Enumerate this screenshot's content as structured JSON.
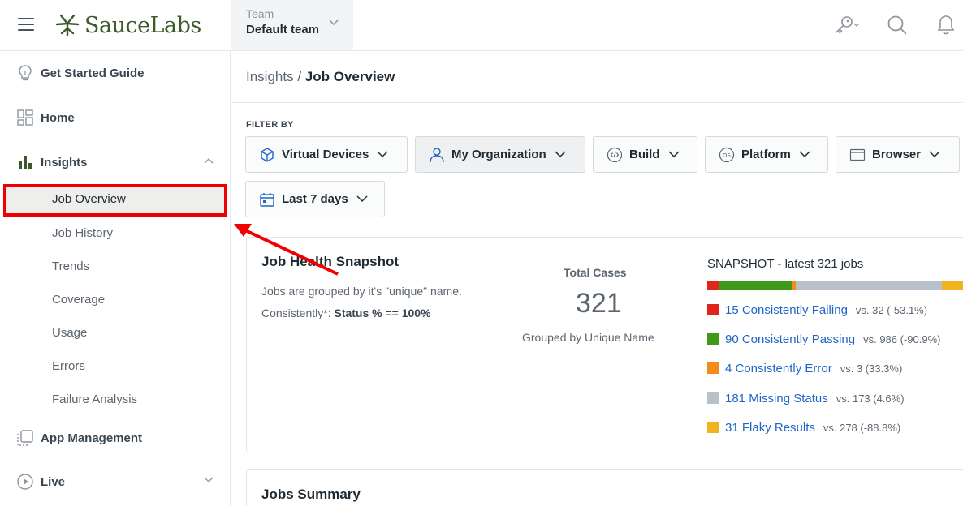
{
  "brand": {
    "name": "SauceLabs",
    "color": "#3d5a2a"
  },
  "team": {
    "label": "Team",
    "value": "Default team"
  },
  "topbar_icons": [
    "key-icon",
    "search-icon",
    "bell-icon"
  ],
  "sidebar": {
    "items": [
      {
        "label": "Get Started Guide",
        "icon": "lightbulb-icon"
      },
      {
        "label": "Home",
        "icon": "home-grid-icon"
      },
      {
        "label": "Insights",
        "icon": "bar-chart-icon",
        "expanded": true
      },
      {
        "label": "App Management",
        "icon": "app-management-icon"
      },
      {
        "label": "Live",
        "icon": "play-circle-icon",
        "expanded": false
      }
    ],
    "insights_sub": [
      {
        "label": "Job Overview",
        "active": true
      },
      {
        "label": "Job History"
      },
      {
        "label": "Trends"
      },
      {
        "label": "Coverage"
      },
      {
        "label": "Usage"
      },
      {
        "label": "Errors"
      },
      {
        "label": "Failure Analysis"
      }
    ]
  },
  "breadcrumb": {
    "parent": "Insights",
    "separator": "/",
    "current": "Job Overview"
  },
  "filters": {
    "heading": "FILTER BY",
    "buttons": [
      {
        "label": "Virtual Devices",
        "icon": "cube-icon"
      },
      {
        "label": "My Organization",
        "icon": "user-icon"
      },
      {
        "label": "Build",
        "icon": "build-icon"
      },
      {
        "label": "Platform",
        "icon": "os-icon"
      },
      {
        "label": "Browser",
        "icon": "browser-icon"
      },
      {
        "label": "Last 7 days",
        "icon": "calendar-icon"
      }
    ]
  },
  "snapshot": {
    "title": "Job Health Snapshot",
    "desc1": "Jobs are grouped by it's \"unique\" name.",
    "desc2_prefix": "Consistently*: ",
    "desc2_bold": "Status % == 100%",
    "total_label": "Total Cases",
    "total_value": "321",
    "total_sub": "Grouped by Unique Name",
    "bar_title": "SNAPSHOT - latest 321 jobs",
    "legend": [
      {
        "label": "15 Consistently Failing",
        "vs": "vs. 32 (-53.1%)",
        "color": "#e0261b",
        "count": 15
      },
      {
        "label": "90 Consistently Passing",
        "vs": "vs. 986 (-90.9%)",
        "color": "#3f9a1a",
        "count": 90
      },
      {
        "label": "4 Consistently Error",
        "vs": "vs. 3 (33.3%)",
        "color": "#f58a1f",
        "count": 4
      },
      {
        "label": "181 Missing Status",
        "vs": "vs. 173 (4.6%)",
        "color": "#b8c0c9",
        "count": 181
      },
      {
        "label": "31 Flaky Results",
        "vs": "vs. 278 (-88.8%)",
        "color": "#f2b320",
        "count": 31
      }
    ]
  },
  "jobs_summary": {
    "title": "Jobs Summary"
  },
  "colors": {
    "link": "#1f66c7",
    "highlight": "#f00000"
  }
}
